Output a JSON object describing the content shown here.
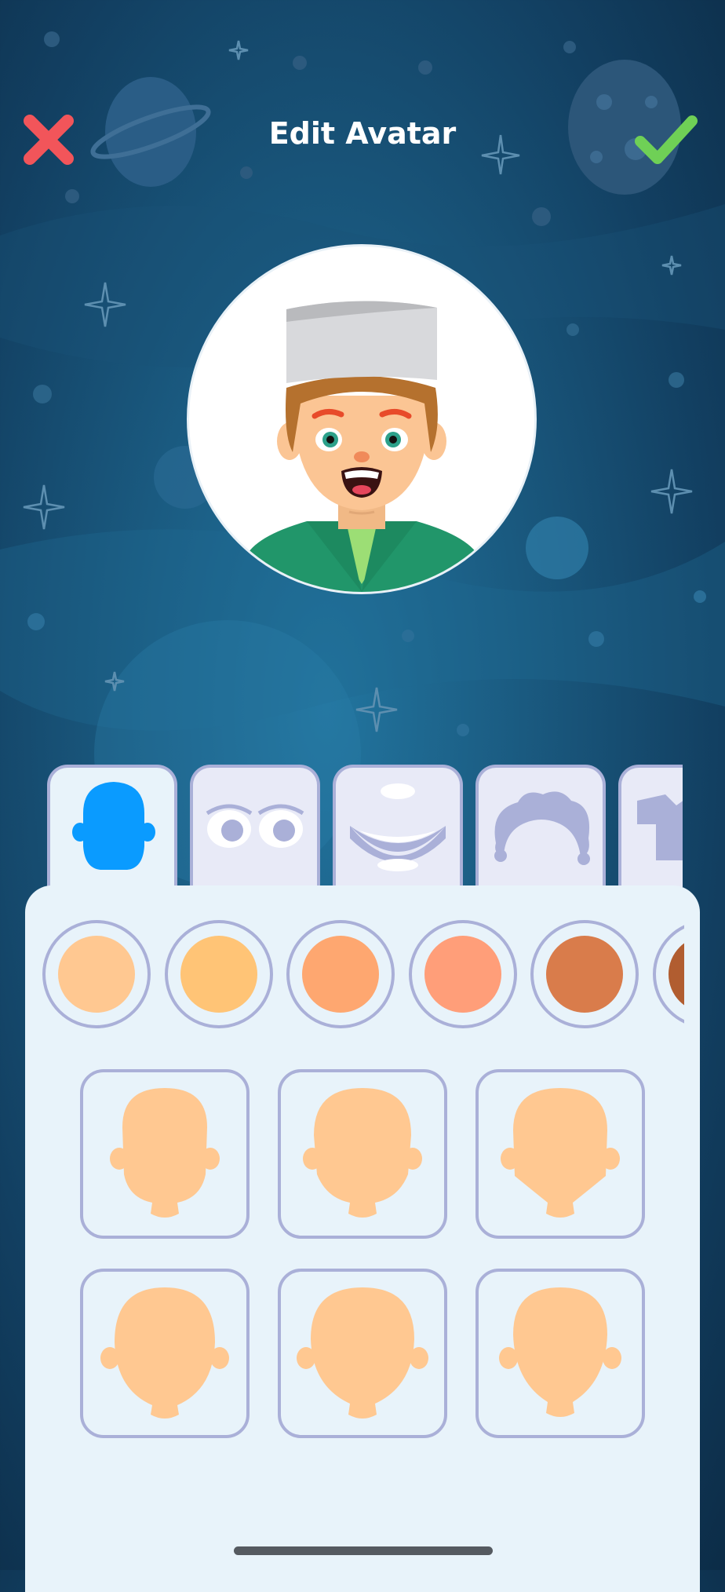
{
  "header": {
    "title": "Edit Avatar",
    "close_icon": "close-x-icon",
    "confirm_icon": "checkmark-icon"
  },
  "colors": {
    "close": "#f2555a",
    "confirm": "#6fd056",
    "active_tab_icon": "#0a9bff",
    "inactive_tab_icon": "#aab0d8",
    "panel_bg": "#e8f3fa",
    "outline": "#aab0d8",
    "head_shape": "#ffc891"
  },
  "avatar_preview": {
    "description_icon": "avatar-boy-chef-hat",
    "hat_color": "#d8d9dc",
    "hair_color": "#b5712e",
    "skin_color": "#fbc594",
    "shirt_color": "#21966a",
    "collar_color": "#9cde75"
  },
  "category_tabs": [
    {
      "icon": "face-shape-icon",
      "active": true
    },
    {
      "icon": "eyes-icon",
      "active": false
    },
    {
      "icon": "mouth-icon",
      "active": false
    },
    {
      "icon": "hair-icon",
      "active": false
    },
    {
      "icon": "clothes-icon",
      "active": false
    }
  ],
  "skin_colors": [
    "#ffc891",
    "#ffc476",
    "#fea770",
    "#ff9e79",
    "#d97c4b",
    "#b15d30"
  ],
  "head_shapes": [
    {
      "icon": "head-shape-1-icon"
    },
    {
      "icon": "head-shape-2-icon"
    },
    {
      "icon": "head-shape-3-icon"
    },
    {
      "icon": "head-shape-4-icon"
    },
    {
      "icon": "head-shape-5-icon"
    },
    {
      "icon": "head-shape-6-icon"
    }
  ]
}
